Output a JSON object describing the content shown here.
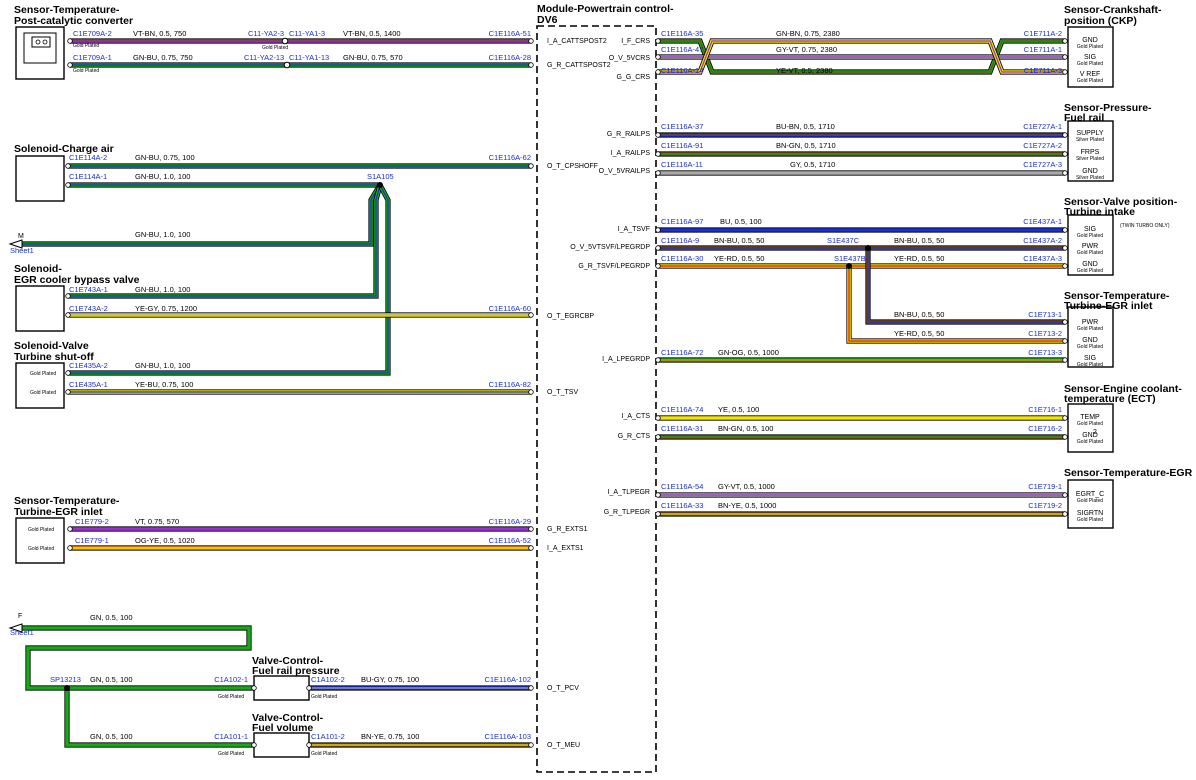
{
  "module": {
    "title1": "Module-Powertrain control-",
    "title2": "DV6"
  },
  "colors": {
    "VT": "#9b30d0",
    "BN": "#7a4a1c",
    "GN": "#16a816",
    "BU": "#1a2fd0",
    "GY": "#aaaaaa",
    "YE": "#f2e600",
    "OG": "#ff8c00",
    "RD": "#e01010"
  },
  "components": [
    {
      "id": "c1",
      "title1": "Sensor-Temperature-",
      "title2": "Post-catalytic converter"
    },
    {
      "id": "c2",
      "title1": "Solenoid-Charge air",
      "title2": ""
    },
    {
      "id": "c3",
      "title1": "Solenoid-",
      "title2": "EGR cooler bypass valve"
    },
    {
      "id": "c4",
      "title1": "Solenoid-Valve",
      "title2": "Turbine shut-off",
      "pins": [
        "Gold Plated",
        "Gold Plated"
      ]
    },
    {
      "id": "c5",
      "title1": "Sensor-Temperature-",
      "title2": "Turbine-EGR inlet",
      "pins": [
        "Gold Plated",
        "Gold Plated"
      ]
    },
    {
      "id": "c6",
      "title1": "Sensor-Crankshaft-",
      "title2": "position (CKP)",
      "pins": [
        [
          "GND",
          "Gold Plated"
        ],
        [
          "SIG",
          "Gold Plated"
        ],
        [
          "V REF",
          "Gold Plated"
        ]
      ]
    },
    {
      "id": "c7",
      "title1": "Sensor-Pressure-",
      "title2": "Fuel rail",
      "pins": [
        [
          "SUPPLY",
          "Silver Plated"
        ],
        [
          "FRPS",
          "Silver Plated"
        ],
        [
          "GND",
          "Silver Plated"
        ]
      ]
    },
    {
      "id": "c8",
      "title1": "Sensor-Valve position-",
      "title2": "Turbine intake",
      "note": "(TWIN TURBO ONLY)",
      "pins": [
        [
          "SIG",
          "Gold Plated"
        ],
        [
          "PWR",
          "Gold Plated"
        ],
        [
          "GND",
          "Gold Plated"
        ]
      ]
    },
    {
      "id": "c9",
      "title1": "Sensor-Temperature-",
      "title2": "Turbine-EGR inlet",
      "pins": [
        [
          "PWR",
          "Gold Plated"
        ],
        [
          "GND",
          "Gold Plated"
        ],
        [
          "SIG",
          "Gold Plated"
        ]
      ]
    },
    {
      "id": "c10",
      "title1": "Sensor-Engine coolant-",
      "title2": "temperature (ECT)",
      "pins": [
        [
          "TEMP",
          "Gold Plated"
        ],
        [
          "GND",
          "Gold Plated"
        ]
      ],
      "extra": "2"
    },
    {
      "id": "c11",
      "title1": "Sensor-Temperature-EGR",
      "title2": "",
      "pins": [
        [
          "EGRT_C",
          "Gold Plated"
        ],
        [
          "SIGRTN",
          "Gold Plated"
        ]
      ]
    },
    {
      "id": "c12",
      "title1": "Valve-Control-",
      "title2": "Fuel rail pressure"
    },
    {
      "id": "c13",
      "title1": "Valve-Control-",
      "title2": "Fuel volume"
    }
  ],
  "wires": [
    {
      "id": "w1",
      "c1": "VT",
      "c2": "BN",
      "from": "C1E709A-2",
      "spec": "VT-BN,  0.5,  750",
      "mid1": "C11-YA2-3",
      "mid2": "C11-YA1-3",
      "spec2": "VT-BN,  0.5,  1400",
      "to": "C1E116A-51",
      "sig": "I_A_CATTSPOST2",
      "plate": "Gold Plated"
    },
    {
      "id": "w2",
      "c1": "GN",
      "c2": "BU",
      "from": "C1E709A-1",
      "spec": "GN-BU,  0.75,  750",
      "mid1": "C11-YA2-13",
      "mid2": "C11-YA1-13",
      "spec2": "GN-BU,  0.75,  570",
      "to": "C1E116A-28",
      "sig": "G_R_CATTSPOST2",
      "plate": "Gold Plated"
    },
    {
      "id": "w3",
      "c1": "GN",
      "c2": "BU",
      "from": "C1E114A-2",
      "spec": "GN-BU,  0.75,  100",
      "to": "C1E116A-62",
      "sig": "O_T_CPSHOFF"
    },
    {
      "id": "w4",
      "c1": "GN",
      "c2": "BU",
      "from": "C1E114A-1",
      "spec": "GN-BU,  1.0,  100",
      "splice": "S1A105"
    },
    {
      "id": "w5",
      "c1": "GN",
      "c2": "BU",
      "spec": "GN-BU,  1.0,  100",
      "ref": "M",
      "sheet": "Sheet1"
    },
    {
      "id": "w6",
      "c1": "GN",
      "c2": "BU",
      "from": "C1E743A-1",
      "spec": "GN-BU,  1.0,  100"
    },
    {
      "id": "w7",
      "c1": "YE",
      "c2": "GY",
      "from": "C1E743A-2",
      "spec": "YE-GY,  0.75,  1200",
      "to": "C1E116A-60",
      "sig": "O_T_EGRCBP"
    },
    {
      "id": "w8",
      "c1": "GN",
      "c2": "BU",
      "from": "C1E435A-2",
      "spec": "GN-BU,  1.0,  100"
    },
    {
      "id": "w9",
      "c1": "YE",
      "c2": "BU",
      "from": "C1E435A-1",
      "spec": "YE-BU,  0.75,  100",
      "to": "C1E116A-82",
      "sig": "O_T_TSV"
    },
    {
      "id": "w10",
      "c1": "VT",
      "c2": "VT",
      "from": "C1E779-2",
      "spec": "VT,  0.75,  570",
      "to": "C1E116A-29",
      "sig": "G_R_EXTS1"
    },
    {
      "id": "w11",
      "c1": "OG",
      "c2": "YE",
      "from": "C1E779-1",
      "spec": "OG-YE,  0.5,  1020",
      "to": "C1E116A-52",
      "sig": "I_A_EXTS1"
    },
    {
      "id": "w12",
      "c1": "GN",
      "c2": "GN",
      "spec": "GN,  0.5,  100",
      "ref": "F",
      "sheet": "Sheet1"
    },
    {
      "id": "w13",
      "c1": "GN",
      "c2": "GN",
      "spec": "GN,  0.5,  100",
      "splice": "SP13213",
      "to": "C1A102-1",
      "plate": "Gold Plated"
    },
    {
      "id": "w14",
      "c1": "BU",
      "c2": "GY",
      "from": "C1A102-2",
      "spec": "BU-GY,  0.75,  100",
      "to": "C1E116A-102",
      "sig": "O_T_PCV",
      "plate": "Gold Plated"
    },
    {
      "id": "w15",
      "c1": "GN",
      "c2": "GN",
      "spec": "GN,  0.5,  100",
      "to": "C1A101-1",
      "plate": "Gold Plated"
    },
    {
      "id": "w16",
      "c1": "BN",
      "c2": "YE",
      "from": "C1A101-2",
      "spec": "BN-YE,  0.75,  100",
      "to": "C1E116A-103",
      "sig": "O_T_MEU",
      "plate": "Gold Plated"
    },
    {
      "id": "r1",
      "c1": "GN",
      "c2": "BN",
      "from": "C1E116A-35",
      "spec": "GN-BN,  0.75,  2380",
      "to": "C1E711A-2",
      "sig": "I_F_CRS"
    },
    {
      "id": "r2",
      "c1": "GY",
      "c2": "VT",
      "from": "C1E116A-47",
      "spec": "GY-VT,  0.75,  2380",
      "to": "C1E711A-1",
      "sig": "O_V_5VCRS"
    },
    {
      "id": "r3",
      "c1": "YE",
      "c2": "VT",
      "from": "C1E116A-14",
      "spec": "YE-VT,  0.5,  2380",
      "to": "C1E711A-3",
      "sig": "G_G_CRS"
    },
    {
      "id": "r4",
      "c1": "BU",
      "c2": "BN",
      "from": "C1E116A-37",
      "spec": "BU-BN,  0.5,  1710",
      "to": "C1E727A-1",
      "sig": "G_R_RAILPS"
    },
    {
      "id": "r5",
      "c1": "BN",
      "c2": "GN",
      "from": "C1E116A-91",
      "spec": "BN-GN,  0.5,  1710",
      "to": "C1E727A-2",
      "sig": "I_A_RAILPS"
    },
    {
      "id": "r6",
      "c1": "GY",
      "c2": "GY",
      "from": "C1E116A-11",
      "spec": "GY,  0.5,  1710",
      "to": "C1E727A-3",
      "sig": "O_V_5VRAILPS"
    },
    {
      "id": "r7",
      "c1": "BU",
      "c2": "BU",
      "from": "C1E116A-97",
      "spec": "BU,  0.5,  100",
      "to": "C1E437A-1",
      "sig": "I_A_TSVF"
    },
    {
      "id": "r8",
      "c1": "BN",
      "c2": "BU",
      "from": "C1E116A-9",
      "spec": "BN-BU,  0.5,  50",
      "splice": "S1E437C",
      "spec2": "BN-BU,  0.5,  50",
      "to": "C1E437A-2",
      "sig": "O_V_5VTSVF/LPEGRDP"
    },
    {
      "id": "r9",
      "c1": "YE",
      "c2": "RD",
      "from": "C1E116A-30",
      "spec": "YE-RD,  0.5,  50",
      "splice": "S1E437B",
      "spec2": "YE-RD,  0.5,  50",
      "to": "C1E437A-3",
      "sig": "G_R_TSVF/LPEGRDP"
    },
    {
      "id": "r10",
      "c1": "BN",
      "c2": "BU",
      "spec": "BN-BU,  0.5,  50",
      "to": "C1E713-1"
    },
    {
      "id": "r11",
      "c1": "YE",
      "c2": "RD",
      "spec": "YE-RD,  0.5,  50",
      "to": "C1E713-2"
    },
    {
      "id": "r12",
      "c1": "GN",
      "c2": "OG",
      "from": "C1E116A-72",
      "spec": "GN-OG,  0.5,  1000",
      "to": "C1E713-3",
      "sig": "I_A_LPEGRDP"
    },
    {
      "id": "r13",
      "c1": "YE",
      "c2": "YE",
      "from": "C1E116A-74",
      "spec": "YE,  0.5,  100",
      "to": "C1E716-1",
      "sig": "I_A_CTS"
    },
    {
      "id": "r14",
      "c1": "BN",
      "c2": "GN",
      "from": "C1E116A-31",
      "spec": "BN-GN,  0.5,  100",
      "to": "C1E716-2",
      "sig": "G_R_CTS"
    },
    {
      "id": "r15",
      "c1": "GY",
      "c2": "VT",
      "from": "C1E116A-54",
      "spec": "GY-VT,  0.5,  1000",
      "to": "C1E719-1",
      "sig": "I_A_TLPEGR"
    },
    {
      "id": "r16",
      "c1": "BN",
      "c2": "YE",
      "from": "C1E116A-33",
      "spec": "BN-YE,  0.5,  1000",
      "to": "C1E719-2",
      "sig": "G_R_TLPEGR"
    }
  ]
}
